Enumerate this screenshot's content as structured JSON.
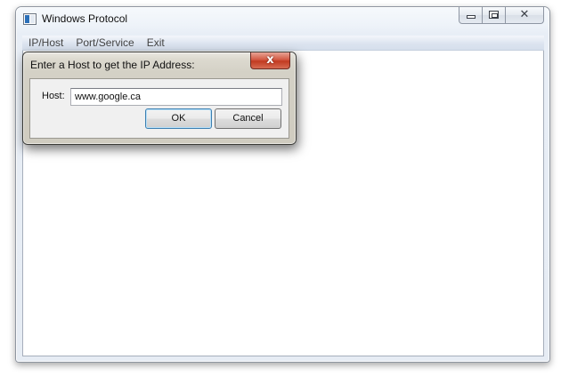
{
  "window": {
    "title": "Windows Protocol",
    "icon": "app-window-icon",
    "caption_buttons": {
      "minimize": "minimize-icon",
      "maximize": "maximize-icon",
      "close": "✕"
    }
  },
  "menu": {
    "items": [
      {
        "label": "IP/Host"
      },
      {
        "label": "Port/Service"
      },
      {
        "label": "Exit"
      }
    ]
  },
  "dialog": {
    "title": "Enter a Host to get the IP Address:",
    "close_glyph": "x",
    "host_label": "Host:",
    "host_value": "www.google.ca",
    "ok_label": "OK",
    "cancel_label": "Cancel"
  },
  "colors": {
    "dialog_close": "#c23a21",
    "default_button_border": "#3c7fb1"
  }
}
